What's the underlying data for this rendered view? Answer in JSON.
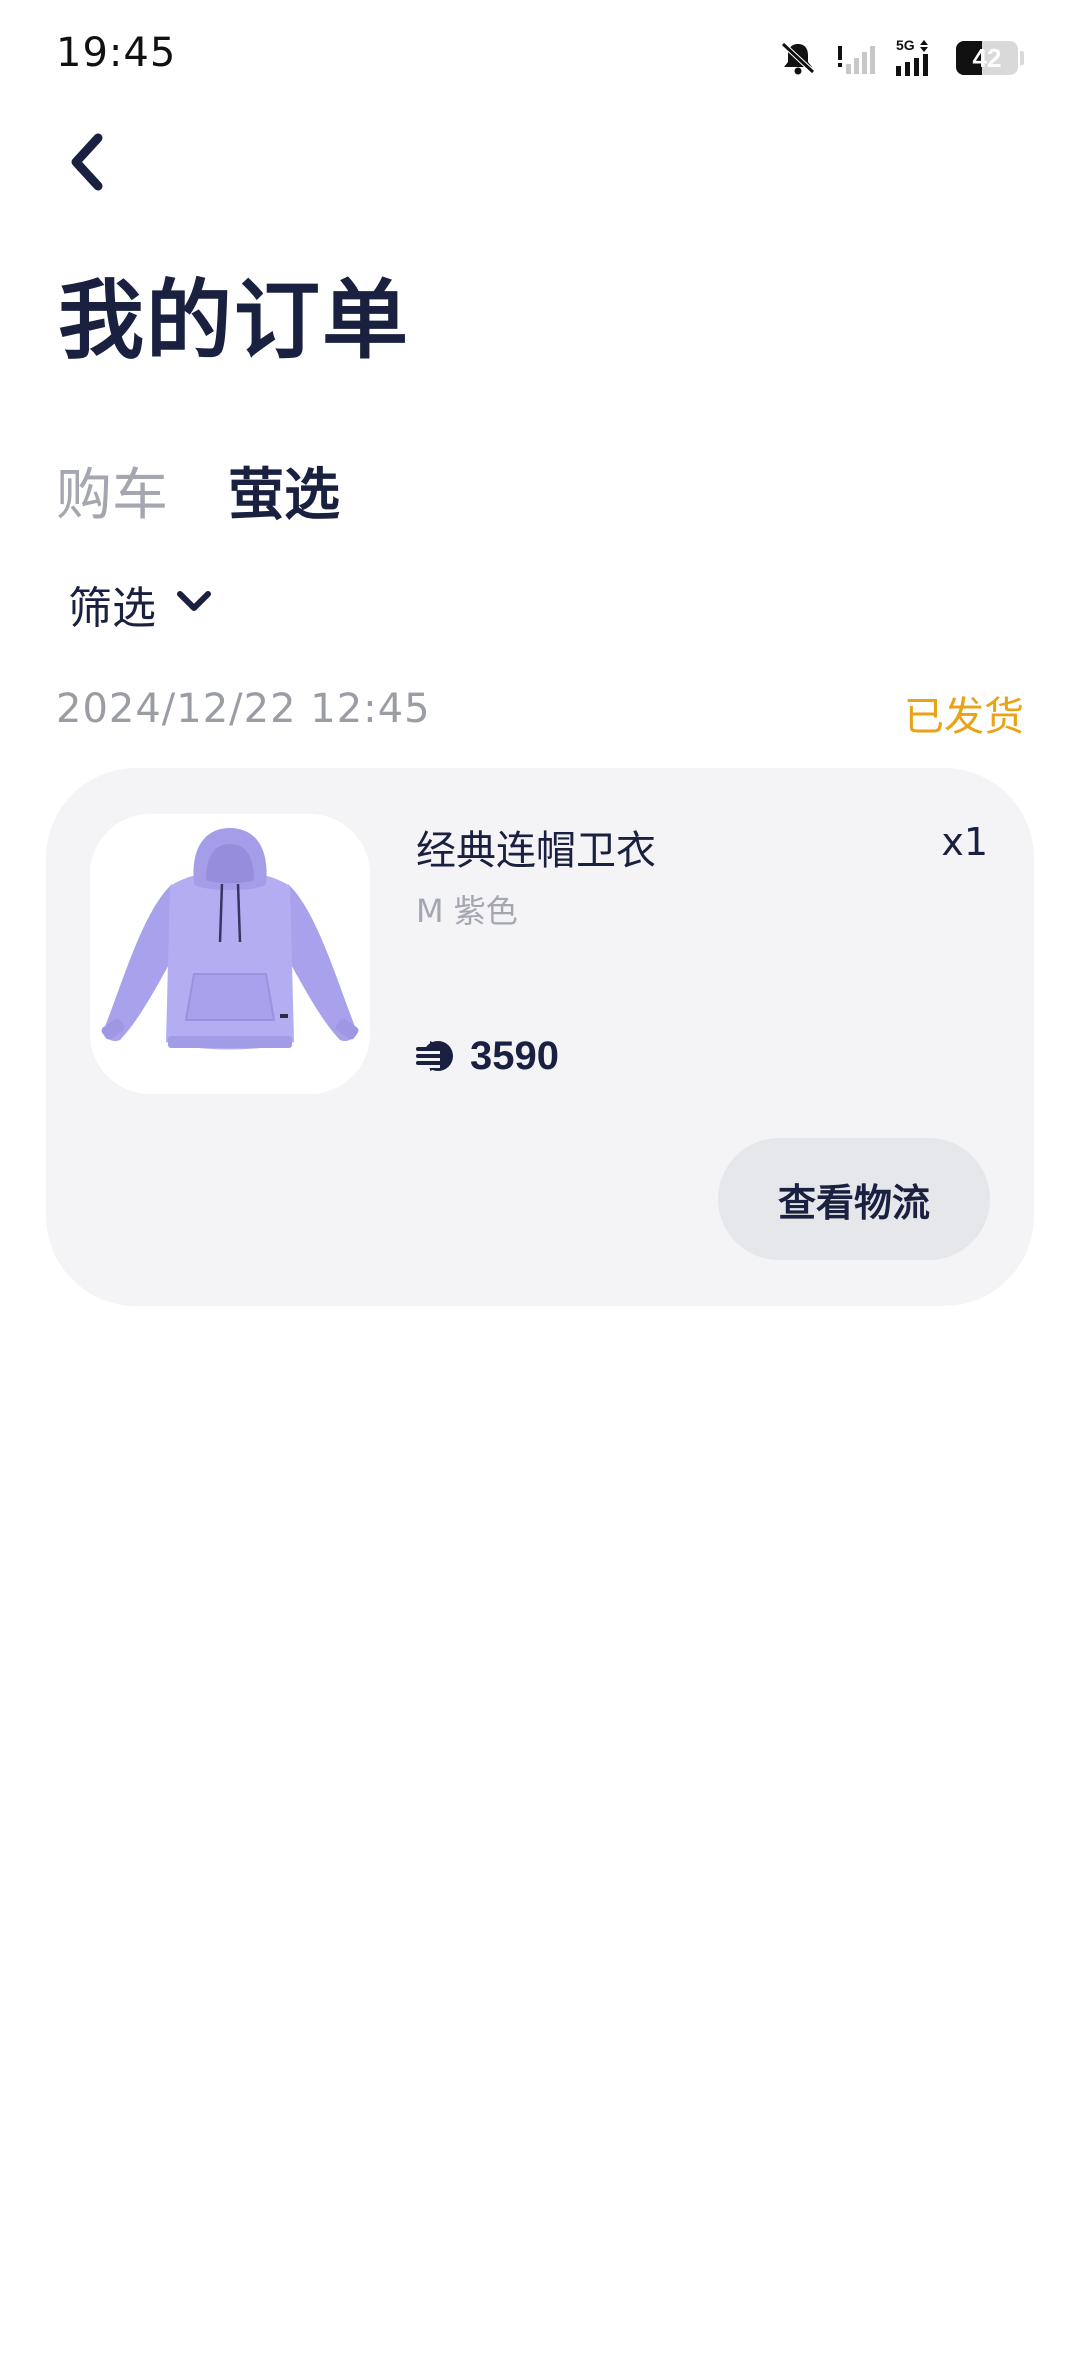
{
  "status_bar": {
    "time": "19:45",
    "network": "5G",
    "battery": "42",
    "battery_level": 0.42,
    "icons": [
      "bell-off-icon",
      "signal-weak-icon",
      "signal-5g-icon",
      "battery-icon"
    ]
  },
  "header": {
    "back_icon": "chevron-left-icon",
    "title": "我的订单"
  },
  "tabs": [
    {
      "label": "购车",
      "active": false
    },
    {
      "label": "萤选",
      "active": true
    }
  ],
  "filter": {
    "label": "筛选",
    "icon": "chevron-down-icon"
  },
  "orders": [
    {
      "date": "2024/12/22 12:45",
      "status": "已发货",
      "status_color": "#e8a317",
      "product": {
        "name": "经典连帽卫衣",
        "variant": "M 紫色",
        "quantity": "x1",
        "price": "3590",
        "price_icon": "coin-icon",
        "image": "purple-hoodie-image"
      },
      "action_label": "查看物流"
    }
  ],
  "colors": {
    "primary_text": "#1a2140",
    "muted_text": "#a4a7b0",
    "card_background": "#f4f4f6",
    "button_background": "#e6e7ea",
    "status_accent": "#e8a317"
  }
}
